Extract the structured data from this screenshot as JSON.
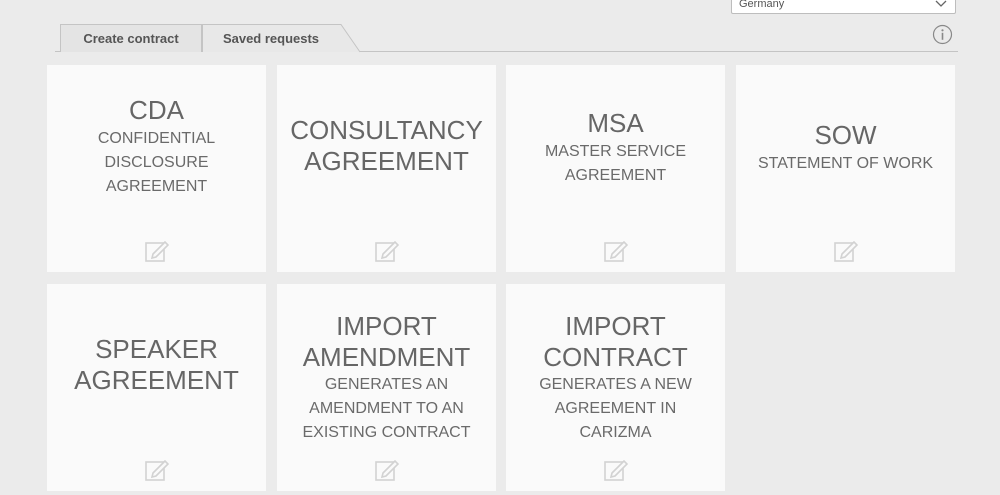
{
  "country_select": {
    "value": "Germany"
  },
  "tabs": [
    {
      "label": "Create contract"
    },
    {
      "label": "Saved requests"
    }
  ],
  "cards": [
    {
      "title": "CDA",
      "subtitle": "CONFIDENTIAL DISCLOSURE AGREEMENT"
    },
    {
      "title": "CONSULTANCY AGREEMENT",
      "subtitle": ""
    },
    {
      "title": "MSA",
      "subtitle": "MASTER SERVICE AGREEMENT"
    },
    {
      "title": "SOW",
      "subtitle": "STATEMENT OF WORK"
    },
    {
      "title": "SPEAKER AGREEMENT",
      "subtitle": ""
    },
    {
      "title": "IMPORT AMENDMENT",
      "subtitle": "GENERATES AN AMENDMENT TO AN EXISTING CONTRACT"
    },
    {
      "title": "IMPORT CONTRACT",
      "subtitle": "GENERATES A NEW AGREEMENT IN CARIZMA"
    }
  ],
  "icons": {
    "info": "info-icon",
    "edit": "edit-icon",
    "dropdown": "chevron-down-icon"
  }
}
